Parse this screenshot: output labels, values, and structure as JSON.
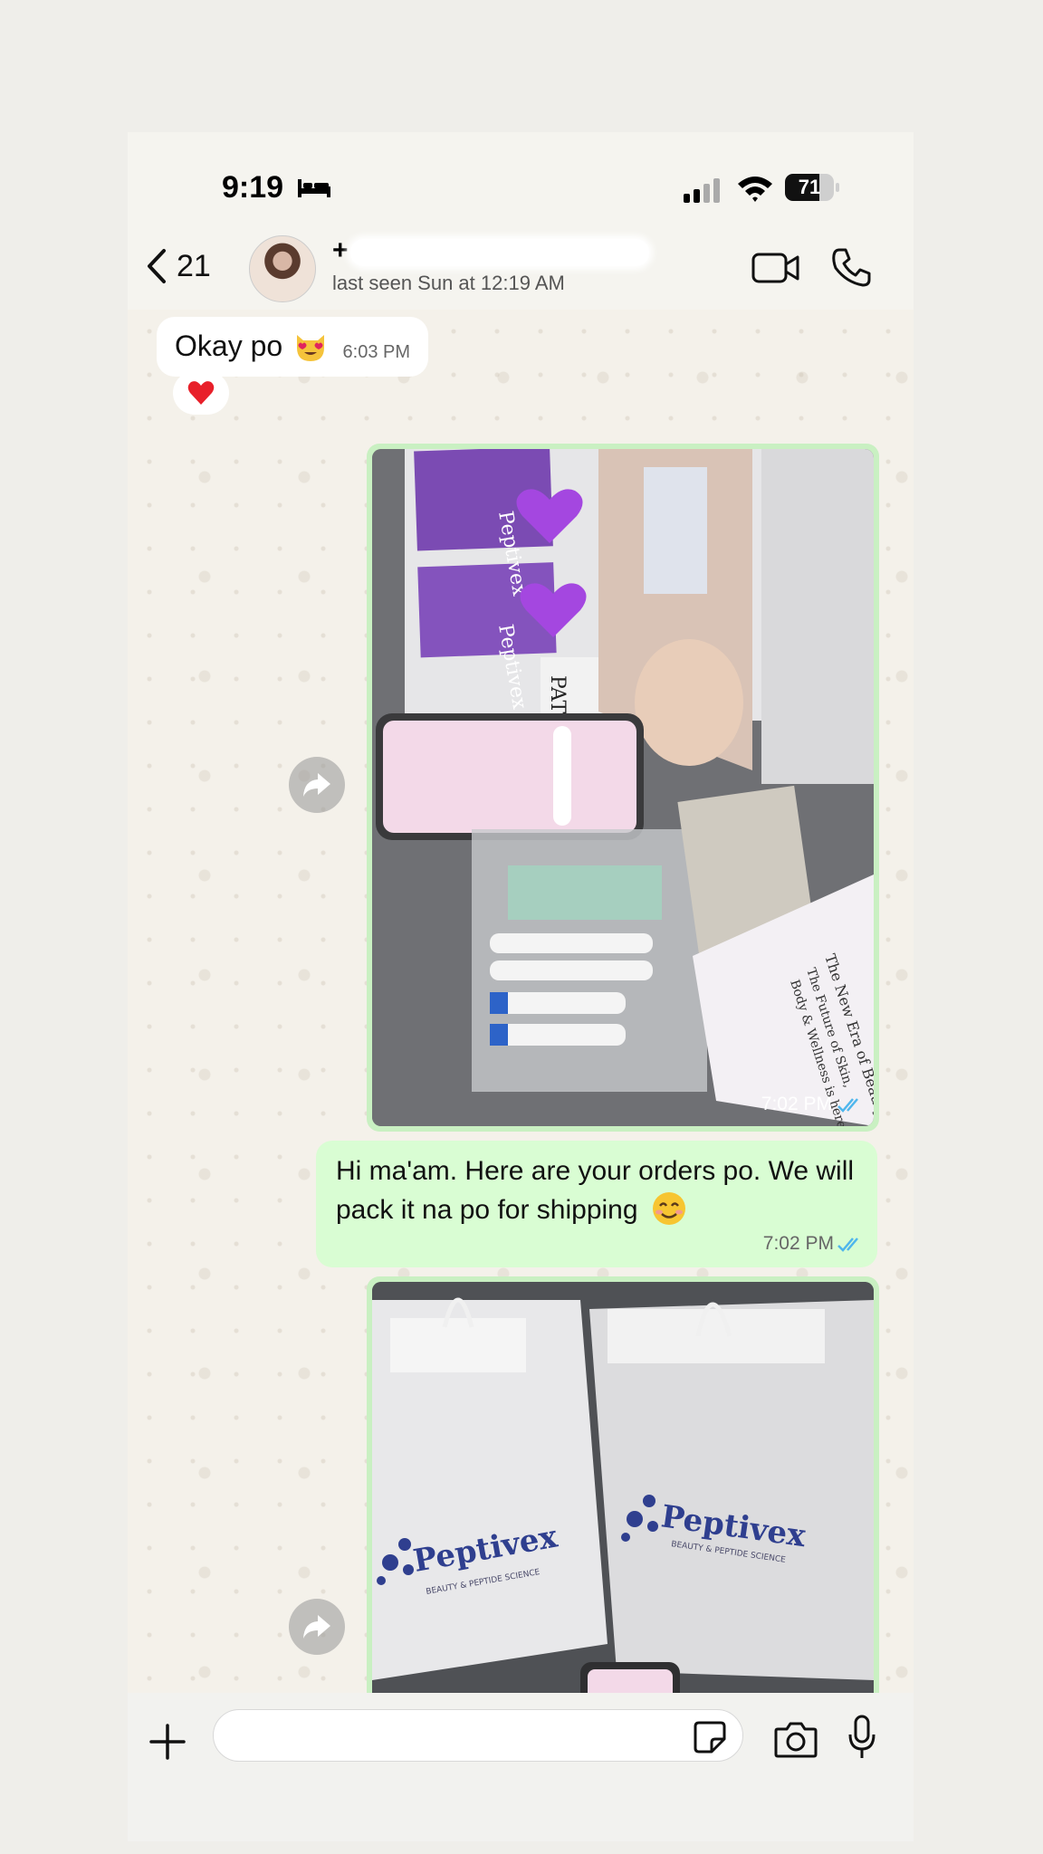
{
  "status_bar": {
    "time": "9:19",
    "battery": "71",
    "battery_level": 0.71
  },
  "header": {
    "back_count": "21",
    "contact_name": "+",
    "last_seen": "last seen Sun at 12:19 AM"
  },
  "messages": [
    {
      "direction": "incoming",
      "text": "Okay po",
      "emoji": "heart-eyes-cat",
      "time": "6:03 PM",
      "reaction": "red-heart"
    },
    {
      "direction": "outgoing",
      "type": "image",
      "time": "7:02 PM",
      "status": "read",
      "image_text": {
        "brand": "Peptivex",
        "card_line_1": "The New Era of Beauty",
        "card_line_2": "The Future of Skin,",
        "card_line_3": "Body & Wellness is here",
        "partial_word": "PATID"
      }
    },
    {
      "direction": "outgoing",
      "type": "text",
      "text": "Hi ma'am. Here are your orders po. We will pack it na po for shipping",
      "emoji": "smiling-face",
      "time": "7:02 PM",
      "status": "read"
    },
    {
      "direction": "outgoing",
      "type": "image",
      "image_text": {
        "brand": "Peptivex",
        "tagline": "BEAUTY & PEPTIDE SCIENCE"
      }
    }
  ],
  "input": {
    "placeholder": ""
  },
  "colors": {
    "outgoing_bubble": "#d9fdd3",
    "incoming_bubble": "#ffffff",
    "read_ticks": "#4fb6ec",
    "brand_purple": "#7b4bb3"
  }
}
